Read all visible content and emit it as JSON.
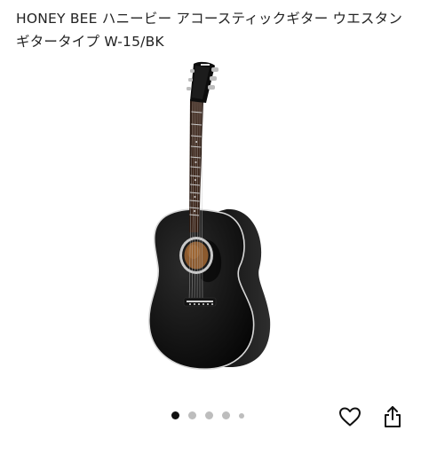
{
  "product": {
    "title": "HONEY BEE ハニービー アコースティックギター ウエスタンギタータイプ W-15/BK"
  },
  "gallery": {
    "image_subject": "guitar-image",
    "total_pages": 5,
    "current_page": 1
  },
  "actions": {
    "favorite_icon": "heart-outline-icon",
    "share_icon": "share-icon"
  },
  "colors": {
    "active_dot": "#111111",
    "inactive_dot": "#bdbdbd"
  }
}
